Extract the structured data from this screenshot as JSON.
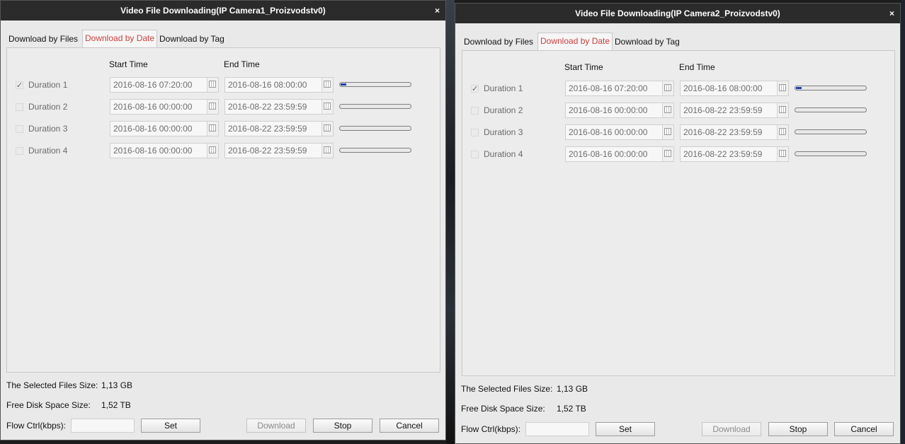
{
  "dialogs": [
    {
      "title": "Video File Downloading(IP Camera1_Proizvodstv0)",
      "close": "×",
      "tabs": [
        "Download by Files",
        "Download by Date",
        "Download by Tag"
      ],
      "active_tab": "Download by Date",
      "columns": {
        "start": "Start Time",
        "end": "End Time"
      },
      "rows": [
        {
          "label": "Duration 1",
          "checked": true,
          "start": "2016-08-16 07:20:00",
          "end": "2016-08-16 08:00:00",
          "progress": 0.08
        },
        {
          "label": "Duration 2",
          "checked": false,
          "start": "2016-08-16 00:00:00",
          "end": "2016-08-22 23:59:59",
          "progress": 0
        },
        {
          "label": "Duration 3",
          "checked": false,
          "start": "2016-08-16 00:00:00",
          "end": "2016-08-22 23:59:59",
          "progress": 0
        },
        {
          "label": "Duration 4",
          "checked": false,
          "start": "2016-08-16 00:00:00",
          "end": "2016-08-22 23:59:59",
          "progress": 0
        }
      ],
      "selected_size_label": "The Selected Files Size:",
      "selected_size_value": "1,13 GB",
      "free_space_label": "Free Disk Space Size:",
      "free_space_value": "1,52 TB",
      "flow_label": "Flow Ctrl(kbps):",
      "flow_value": "",
      "buttons": {
        "set": "Set",
        "download": "Download",
        "stop": "Stop",
        "cancel": "Cancel"
      }
    },
    {
      "title": "Video File Downloading(IP Camera2_Proizvodstv0)",
      "close": "×",
      "tabs": [
        "Download by Files",
        "Download by Date",
        "Download by Tag"
      ],
      "active_tab": "Download by Date",
      "columns": {
        "start": "Start Time",
        "end": "End Time"
      },
      "rows": [
        {
          "label": "Duration 1",
          "checked": true,
          "start": "2016-08-16 07:20:00",
          "end": "2016-08-16 08:00:00",
          "progress": 0.08
        },
        {
          "label": "Duration 2",
          "checked": false,
          "start": "2016-08-16 00:00:00",
          "end": "2016-08-22 23:59:59",
          "progress": 0
        },
        {
          "label": "Duration 3",
          "checked": false,
          "start": "2016-08-16 00:00:00",
          "end": "2016-08-22 23:59:59",
          "progress": 0
        },
        {
          "label": "Duration 4",
          "checked": false,
          "start": "2016-08-16 00:00:00",
          "end": "2016-08-22 23:59:59",
          "progress": 0
        }
      ],
      "selected_size_label": "The Selected Files Size:",
      "selected_size_value": "1,13 GB",
      "free_space_label": "Free Disk Space Size:",
      "free_space_value": "1,52 TB",
      "flow_label": "Flow Ctrl(kbps):",
      "flow_value": "",
      "buttons": {
        "set": "Set",
        "download": "Download",
        "stop": "Stop",
        "cancel": "Cancel"
      }
    }
  ],
  "colors": {
    "titlebar": "#2b2b2b",
    "active_tab_text": "#c9403c",
    "progress_fill": "#1f3fa6"
  }
}
